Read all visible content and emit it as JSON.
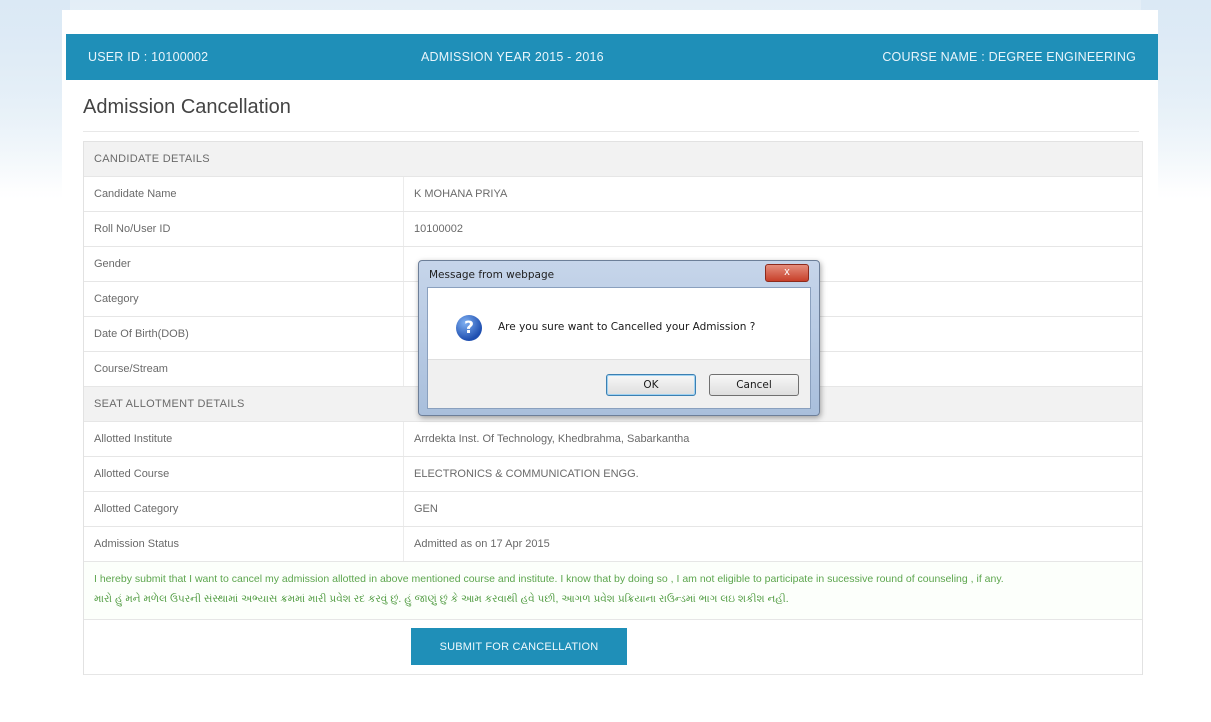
{
  "header": {
    "user_id": "USER ID : 10100002",
    "admission_year": "ADMISSION YEAR 2015 - 2016",
    "course_name": "COURSE NAME : DEGREE ENGINEERING"
  },
  "page_title": "Admission Cancellation",
  "candidate_section": {
    "heading": "CANDIDATE DETAILS",
    "rows": [
      {
        "label": "Candidate Name",
        "value": "K MOHANA PRIYA"
      },
      {
        "label": "Roll No/User ID",
        "value": "10100002"
      },
      {
        "label": "Gender",
        "value": ""
      },
      {
        "label": "Category",
        "value": ""
      },
      {
        "label": "Date Of Birth(DOB)",
        "value": ""
      },
      {
        "label": "Course/Stream",
        "value": ""
      }
    ]
  },
  "seat_section": {
    "heading": "SEAT ALLOTMENT DETAILS",
    "rows": [
      {
        "label": "Allotted Institute",
        "value": "Arrdekta Inst. Of Technology, Khedbrahma, Sabarkantha"
      },
      {
        "label": "Allotted Course",
        "value": "ELECTRONICS & COMMUNICATION ENGG."
      },
      {
        "label": "Allotted Category",
        "value": "GEN"
      },
      {
        "label": "Admission Status",
        "value": "Admitted as on 17 Apr 2015"
      }
    ]
  },
  "declaration": {
    "english": "I hereby submit that I want to cancel my admission allotted in above mentioned course and institute. I know that by doing so , I am not eligible to participate in sucessive round of counseling , if any.",
    "gujarati": "મારો હું મને મળેલ ઉપરની સંસ્થામાં અભ્યાસ ક્રમમાં મારી પ્રવેશ રદ કરવું છું. હું જાણું છું કે આમ કરવાથી હવે પછી, આગળ પ્રવેશ પ્રક્રિયાના રાઉન્ડમાં ભાગ લઇ શકીશ નહી."
  },
  "submit_button": "SUBMIT FOR CANCELLATION",
  "dialog": {
    "title": "Message from webpage",
    "close_glyph": "x",
    "icon_glyph": "?",
    "message": "Are you sure want to Cancelled your Admission ?",
    "ok_label": "OK",
    "cancel_label": "Cancel"
  }
}
